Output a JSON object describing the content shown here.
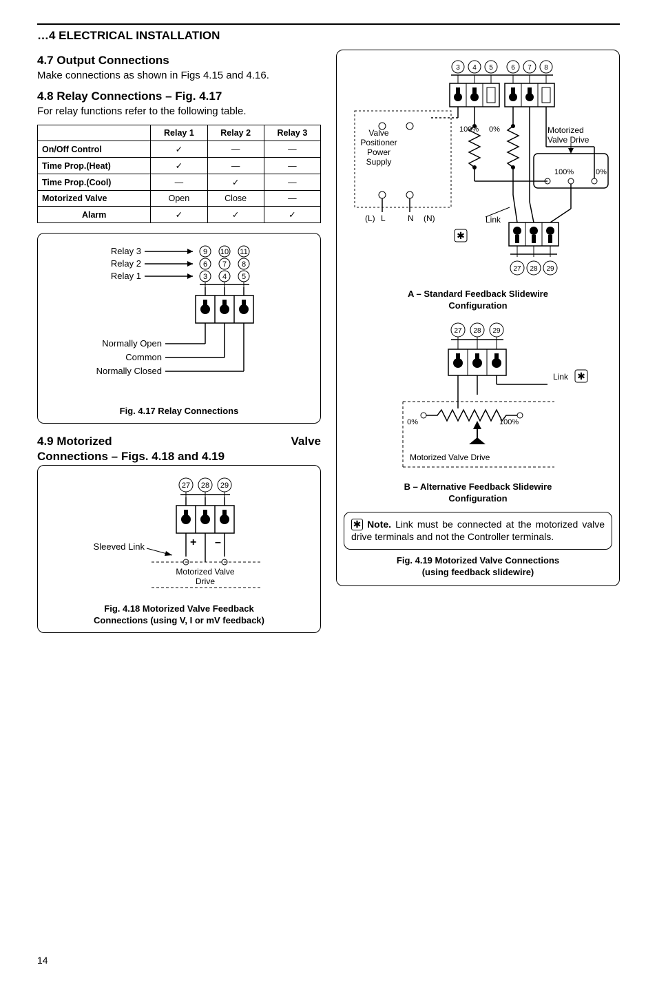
{
  "section_head": "…4  ELECTRICAL INSTALLATION",
  "left": {
    "s47_title": "4.7   Output Connections",
    "s47_text": "Make connections as shown in Figs 4.15 and 4.16.",
    "s48_title": "4.8   Relay Connections – Fig. 4.17",
    "s48_text": "For relay functions refer to the following table.",
    "table": {
      "headers": [
        "",
        "Relay 1",
        "Relay 2",
        "Relay 3"
      ],
      "rows": [
        [
          "On/Off Control",
          "✓",
          "—",
          "—"
        ],
        [
          "Time Prop.(Heat)",
          "✓",
          "—",
          "—"
        ],
        [
          "Time Prop.(Cool)",
          "—",
          "✓",
          "—"
        ],
        [
          "Motorized Valve",
          "Open",
          "Close",
          "—"
        ],
        [
          "Alarm",
          "✓",
          "✓",
          "✓"
        ]
      ]
    },
    "fig417": {
      "relay3": "Relay 3",
      "relay2": "Relay 2",
      "relay1": "Relay 1",
      "no": "Normally Open",
      "com": "Common",
      "nc": "Normally Closed",
      "nums": [
        [
          "9",
          "10",
          "11"
        ],
        [
          "6",
          "7",
          "8"
        ],
        [
          "3",
          "4",
          "5"
        ]
      ],
      "caption": "Fig. 4.17 Relay Connections"
    },
    "s49_title_l": "4.9   Motorized",
    "s49_title_r": "Valve",
    "s49_sub": "Connections – Figs. 4.18 and 4.19",
    "fig418": {
      "nums": [
        "27",
        "28",
        "29"
      ],
      "sleeved": "Sleeved Link",
      "mvd": "Motorized Valve",
      "drive": "Drive",
      "caption1": "Fig. 4.18 Motorized Valve Feedback",
      "caption2": "Connections (using V, I or mV feedback)"
    }
  },
  "right": {
    "fig419": {
      "top_nums": [
        "3",
        "4",
        "5",
        "6",
        "7",
        "8"
      ],
      "bot_nums": [
        "27",
        "28",
        "29"
      ],
      "vp": "Valve",
      "vp2": "Positioner",
      "ps": "Power",
      "ps2": "Supply",
      "p100": "100%",
      "p0": "0%",
      "mvd": "Motorized",
      "mvd2": "Valve Drive",
      "link": "Link",
      "L": "L",
      "Lp": "(L)",
      "N": "N",
      "Np": "(N)",
      "capA": "A – Standard Feedback Slidewire",
      "capA2": "Configuration",
      "capB": "B – Alternative Feedback Slidewire",
      "capB2": "Configuration",
      "alt_link": "Link",
      "alt_mvd": "Motorized Valve Drive",
      "note_label": "Note.",
      "note_text": " Link must be connected at the motorized valve drive terminals and not the Controller terminals.",
      "caption1": "Fig. 4.19 Motorized Valve Connections",
      "caption2": "(using feedback slidewire)"
    }
  },
  "pagenum": "14"
}
